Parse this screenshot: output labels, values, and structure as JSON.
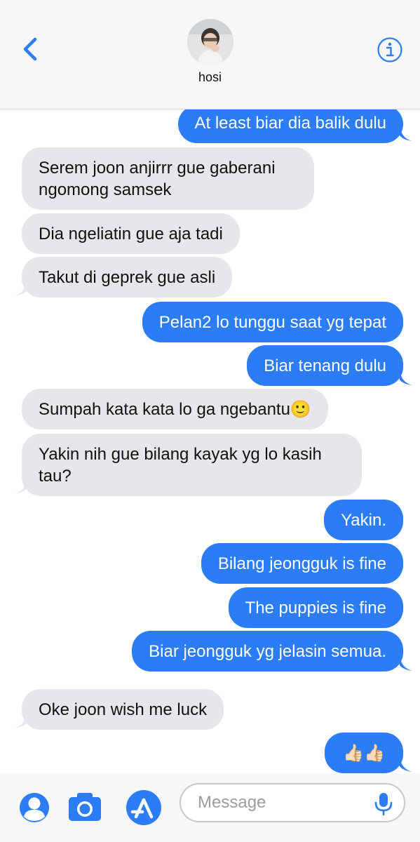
{
  "header": {
    "contact_name": "hosi"
  },
  "messages": [
    {
      "dir": "out",
      "text": "At least biar dia balik dulu"
    },
    {
      "dir": "in",
      "text": "Serem joon anjirrr gue gaberani ngomong samsek"
    },
    {
      "dir": "in",
      "text": "Dia ngeliatin gue aja tadi"
    },
    {
      "dir": "in",
      "text": "Takut di geprek gue asli"
    },
    {
      "dir": "out",
      "text": "Pelan2 lo tunggu saat yg tepat"
    },
    {
      "dir": "out",
      "text": "Biar tenang dulu"
    },
    {
      "dir": "in",
      "text": "Sumpah kata kata lo ga ngebantu🙂"
    },
    {
      "dir": "in",
      "text": "Yakin nih gue bilang kayak yg lo kasih tau?"
    },
    {
      "dir": "out",
      "text": "Yakin."
    },
    {
      "dir": "out",
      "text": "Bilang jeongguk is fine"
    },
    {
      "dir": "out",
      "text": "The puppies is fine"
    },
    {
      "dir": "out",
      "text": "Biar jeongguk yg jelasin semua."
    },
    {
      "dir": "in",
      "text": "Oke joon wish me luck"
    },
    {
      "dir": "out",
      "text": "👍🏻👍🏻"
    }
  ],
  "composer": {
    "placeholder": "Message"
  },
  "colors": {
    "outgoing": "#2b7cf5",
    "incoming": "#e7e6eb",
    "accent": "#2b7cf5"
  },
  "icons": [
    "chevron-left-icon",
    "info-icon",
    "contact-icon",
    "camera-icon",
    "app-store-icon",
    "microphone-icon"
  ]
}
